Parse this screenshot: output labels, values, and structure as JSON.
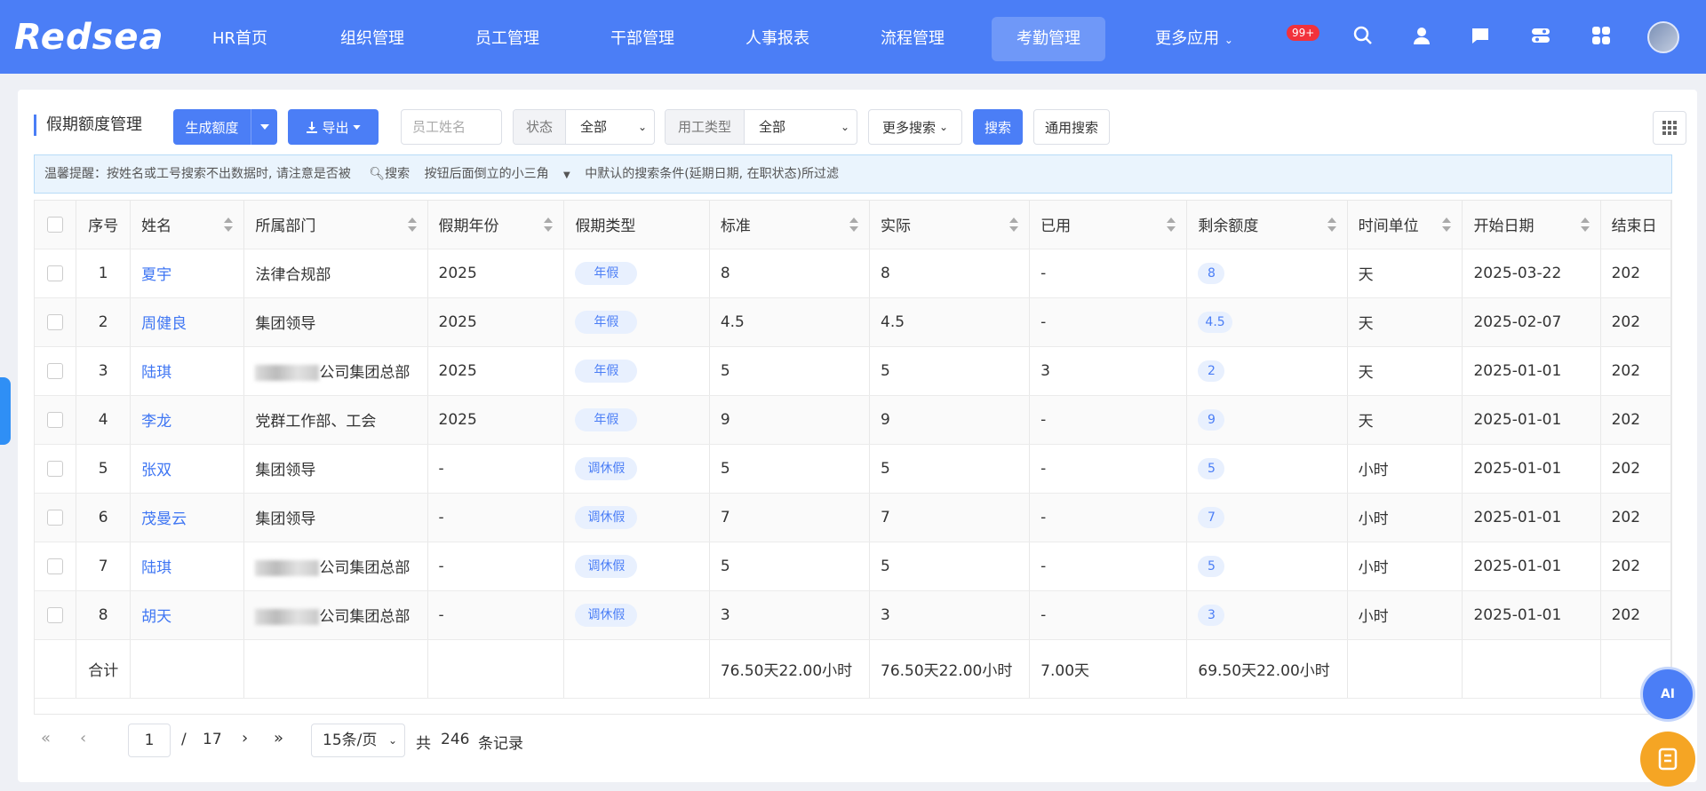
{
  "app": {
    "logo_text": "Redsea"
  },
  "nav": {
    "items": [
      "HR首页",
      "组织管理",
      "员工管理",
      "干部管理",
      "人事报表",
      "流程管理",
      "考勤管理",
      "更多应用"
    ],
    "active": "考勤管理",
    "badge": "99+"
  },
  "toolbar": {
    "title": "假期额度管理",
    "generate_label": "生成额度",
    "export_label": "导出",
    "name_placeholder": "员工姓名",
    "status_label": "状态",
    "status_value": "全部",
    "worktype_label": "用工类型",
    "worktype_value": "全部",
    "more_search_label": "更多搜索",
    "search_label": "搜索",
    "general_search_label": "通用搜索"
  },
  "notice": {
    "text_a": "温馨提醒：按姓名或工号搜索不出数据时, 请注意是否被",
    "text_b": "搜索",
    "text_c": "按钮后面倒立的小三角",
    "text_d": "中默认的搜索条件(延期日期,   在职状态)所过滤"
  },
  "table": {
    "columns": [
      "序号",
      "姓名",
      "所属部门",
      "假期年份",
      "假期类型",
      "标准",
      "实际",
      "已用",
      "剩余额度",
      "时间单位",
      "开始日期",
      "结束日"
    ],
    "rows": [
      {
        "no": "1",
        "name": "夏宇",
        "dept": "法律合规部",
        "dept_prefix": "",
        "year": "2025",
        "type": "年假",
        "std": "8",
        "actual": "8",
        "used": "-",
        "remain": "8",
        "unit": "天",
        "start": "2025-03-22",
        "end": "202"
      },
      {
        "no": "2",
        "name": "周健良",
        "dept": "集团领导",
        "dept_prefix": "",
        "year": "2025",
        "type": "年假",
        "std": "4.5",
        "actual": "4.5",
        "used": "-",
        "remain": "4.5",
        "unit": "天",
        "start": "2025-02-07",
        "end": "202"
      },
      {
        "no": "3",
        "name": "陆琪",
        "dept": "公司集团总部",
        "dept_prefix": "blurred",
        "year": "2025",
        "type": "年假",
        "std": "5",
        "actual": "5",
        "used": "3",
        "remain": "2",
        "unit": "天",
        "start": "2025-01-01",
        "end": "202"
      },
      {
        "no": "4",
        "name": "李龙",
        "dept": "党群工作部、工会",
        "dept_prefix": "",
        "year": "2025",
        "type": "年假",
        "std": "9",
        "actual": "9",
        "used": "-",
        "remain": "9",
        "unit": "天",
        "start": "2025-01-01",
        "end": "202"
      },
      {
        "no": "5",
        "name": "张双",
        "dept": "集团领导",
        "dept_prefix": "",
        "year": "-",
        "type": "调休假",
        "std": "5",
        "actual": "5",
        "used": "-",
        "remain": "5",
        "unit": "小时",
        "start": "2025-01-01",
        "end": "202"
      },
      {
        "no": "6",
        "name": "茂曼云",
        "dept": "集团领导",
        "dept_prefix": "",
        "year": "-",
        "type": "调休假",
        "std": "7",
        "actual": "7",
        "used": "-",
        "remain": "7",
        "unit": "小时",
        "start": "2025-01-01",
        "end": "202"
      },
      {
        "no": "7",
        "name": "陆琪",
        "dept": "公司集团总部",
        "dept_prefix": "blurred",
        "year": "-",
        "type": "调休假",
        "std": "5",
        "actual": "5",
        "used": "-",
        "remain": "5",
        "unit": "小时",
        "start": "2025-01-01",
        "end": "202"
      },
      {
        "no": "8",
        "name": "胡天",
        "dept": "公司集团总部",
        "dept_prefix": "blurred",
        "year": "-",
        "type": "调休假",
        "std": "3",
        "actual": "3",
        "used": "-",
        "remain": "3",
        "unit": "小时",
        "start": "2025-01-01",
        "end": "202"
      }
    ],
    "footer": {
      "label": "合计",
      "std": "76.50天22.00小时",
      "actual": "76.50天22.00小时",
      "used": "7.00天",
      "remain": "69.50天22.00小时"
    }
  },
  "pager": {
    "current": "1",
    "sep": "/",
    "total_pages": "17",
    "page_size": "15条/页",
    "total_prefix": "共",
    "total": "246",
    "total_suffix": "条记录"
  },
  "floating": {
    "ai_label": "AI"
  },
  "colors": {
    "brand": "#4b7ef6",
    "accent_orange": "#f5a524",
    "badge_red": "#f2323b"
  }
}
